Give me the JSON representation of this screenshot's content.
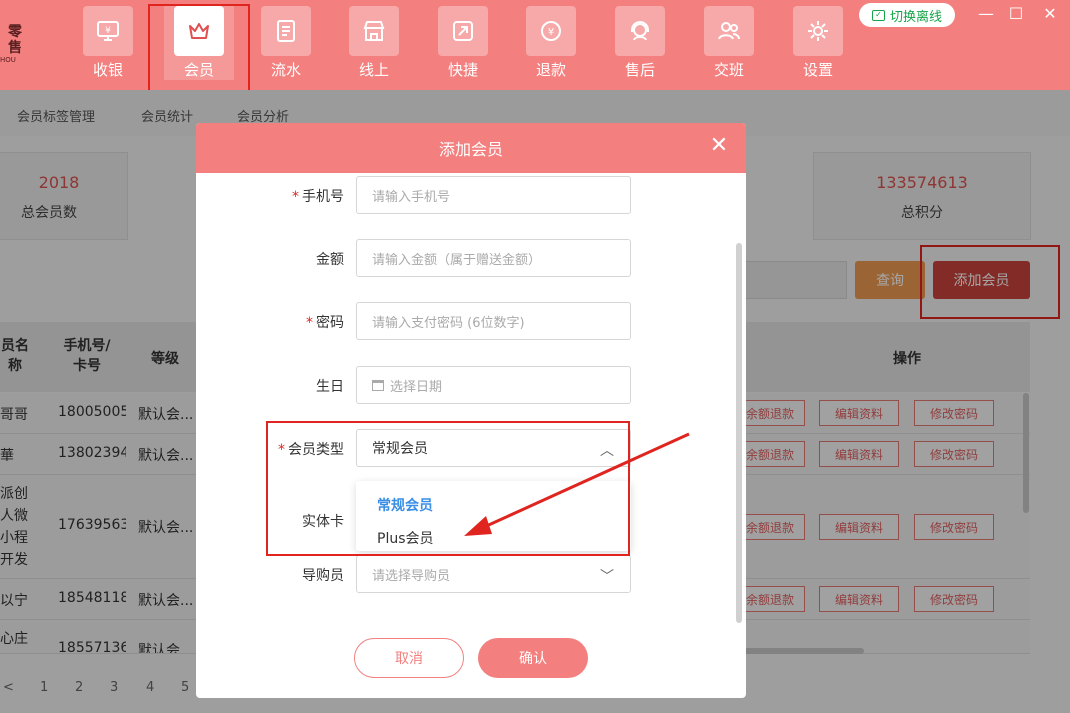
{
  "app": {
    "logo_line1": "零售",
    "logo_line2": "HOU"
  },
  "nav": {
    "items": [
      {
        "label": "收银",
        "icon": "cashier-monitor-icon"
      },
      {
        "label": "会员",
        "icon": "crown-icon"
      },
      {
        "label": "流水",
        "icon": "ledger-icon"
      },
      {
        "label": "线上",
        "icon": "store-icon"
      },
      {
        "label": "快捷",
        "icon": "quick-icon"
      },
      {
        "label": "退款",
        "icon": "refund-icon"
      },
      {
        "label": "售后",
        "icon": "support-icon"
      },
      {
        "label": "交班",
        "icon": "handover-icon"
      },
      {
        "label": "设置",
        "icon": "gear-icon"
      }
    ],
    "active": "会员",
    "offline_label": "切换离线"
  },
  "window_controls": {
    "minimize": "—",
    "maximize": "☐",
    "close": "✕"
  },
  "subtabs": [
    "会员标签管理",
    "会员统计",
    "会员分析"
  ],
  "stats": {
    "members": {
      "value": "2018",
      "caption": "总会员数"
    },
    "points": {
      "value": "133574613",
      "caption": "总积分"
    }
  },
  "toolbar": {
    "query": "查询",
    "add_member": "添加会员"
  },
  "table": {
    "headers": {
      "name": "员名\n称",
      "phone": "手机号/\n卡号",
      "level": "等级",
      "ops": "操作"
    },
    "rows": [
      {
        "name": "哥哥",
        "phone": "18005005",
        "level": "默认会..."
      },
      {
        "name": "華",
        "phone": "13802394",
        "level": "默认会..."
      },
      {
        "name": "派创\n人微\n小程\n开发",
        "phone": "17639563",
        "level": "默认会..."
      },
      {
        "name": "以宁",
        "phone": "18548118",
        "level": "默认会..."
      },
      {
        "name": "心庄",
        "phone": "18557136",
        "level": "默认会..."
      }
    ],
    "op_labels": [
      "余额退款",
      "编辑资料",
      "修改密码"
    ]
  },
  "pagination": [
    "<",
    "1",
    "2",
    "3",
    "4",
    "5"
  ],
  "modal": {
    "title": "添加会员",
    "close": "✕",
    "fields": {
      "phone": {
        "label": "手机号",
        "placeholder": "请输入手机号",
        "required": true
      },
      "amount": {
        "label": "金额",
        "placeholder": "请输入金额（属于赠送金额）"
      },
      "password": {
        "label": "密码",
        "placeholder": "请输入支付密码 (6位数字)",
        "required": true
      },
      "birthday": {
        "label": "生日",
        "placeholder": "选择日期"
      },
      "member_type": {
        "label": "会员类型",
        "value": "常规会员",
        "required": true
      },
      "card": {
        "label": "实体卡"
      },
      "guide": {
        "label": "导购员",
        "placeholder": "请选择导购员"
      }
    },
    "member_type_options": [
      "常规会员",
      "Plus会员"
    ],
    "member_type_selected": "常规会员",
    "cancel": "取消",
    "confirm": "确认"
  },
  "colors": {
    "brand": "#f37f7f",
    "annotation": "#e0241f",
    "link": "#3a8ee6"
  }
}
